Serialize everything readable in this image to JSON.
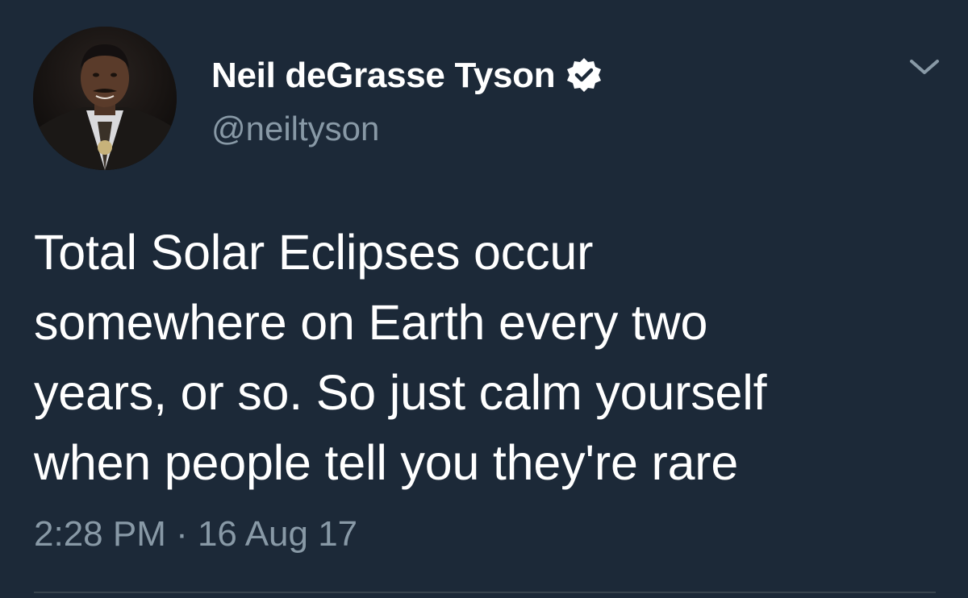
{
  "tweet": {
    "author": {
      "display_name": "Neil deGrasse Tyson",
      "handle": "@neiltyson",
      "verified": true,
      "avatar": "profile-photo"
    },
    "text": "Total Solar Eclipses occur\nsomewhere on Earth every two\nyears, or so. So just calm yourself\nwhen people tell you they're rare",
    "timestamp": "2:28 PM · 16 Aug 17",
    "menu_icon": "chevron-down-icon"
  },
  "colors": {
    "background": "#1c2938",
    "primary_text": "#ffffff",
    "secondary_text": "#8899a6",
    "verified_badge": "#ffffff",
    "divider": "#38444d"
  }
}
